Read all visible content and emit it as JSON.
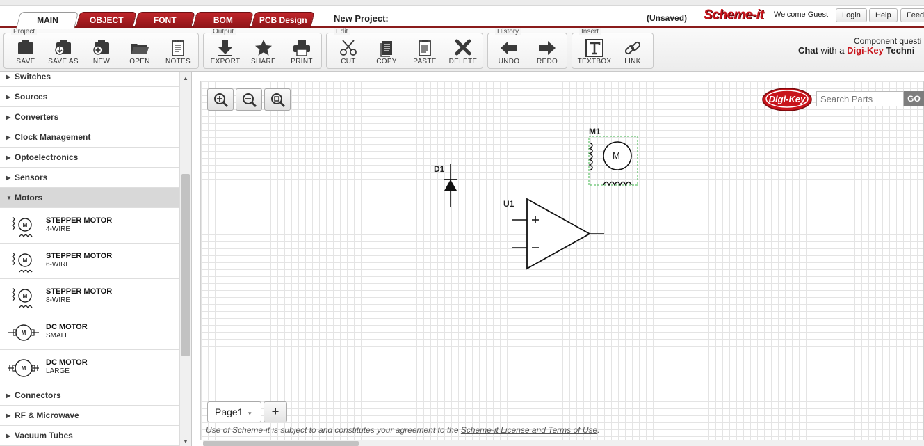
{
  "tabs": [
    {
      "label": "MAIN",
      "active": true
    },
    {
      "label": "OBJECT"
    },
    {
      "label": "FONT"
    },
    {
      "label": "BOM"
    },
    {
      "label": "PCB Design"
    }
  ],
  "header": {
    "project_label": "New Project:",
    "unsaved": "(Unsaved)",
    "brand": "Scheme-it",
    "welcome": "Welcome Guest",
    "buttons": {
      "login": "Login",
      "help": "Help",
      "feedback": "Feed"
    }
  },
  "toolbar": {
    "groups": {
      "project": "Project",
      "output": "Output",
      "edit": "Edit",
      "history": "History",
      "insert": "Insert"
    },
    "buttons": {
      "save": "SAVE",
      "save_as": "SAVE AS",
      "new": "NEW",
      "open": "OPEN",
      "notes": "NOTES",
      "export": "EXPORT",
      "share": "SHARE",
      "print": "PRINT",
      "cut": "CUT",
      "copy": "COPY",
      "paste": "PASTE",
      "delete": "DELETE",
      "undo": "UNDO",
      "redo": "REDO",
      "textbox": "TEXTBOX",
      "link": "LINK"
    }
  },
  "chat": {
    "question": "Component questi",
    "chat": "Chat",
    "with_a": " with a ",
    "brand": "Digi-Key",
    "rest": " Techni"
  },
  "sidebar": {
    "categories_top": [
      "Switches",
      "Sources",
      "Converters",
      "Clock Management",
      "Optoelectronics",
      "Sensors"
    ],
    "open_category": "Motors",
    "items": [
      {
        "name": "STEPPER MOTOR",
        "sub": "4-WIRE",
        "icon": "stepper-motor-icon"
      },
      {
        "name": "STEPPER MOTOR",
        "sub": "6-WIRE",
        "icon": "stepper-motor-icon"
      },
      {
        "name": "STEPPER MOTOR",
        "sub": "8-WIRE",
        "icon": "stepper-motor-icon"
      },
      {
        "name": "DC MOTOR",
        "sub": "SMALL",
        "icon": "dc-motor-icon"
      },
      {
        "name": "DC MOTOR",
        "sub": "LARGE",
        "icon": "dc-motor-icon"
      }
    ],
    "categories_bottom": [
      "Connectors",
      "RF & Microwave",
      "Vacuum Tubes"
    ]
  },
  "canvas": {
    "search_placeholder": "Search Parts",
    "go_label": "GO",
    "logo_text": "Digi-Key",
    "components": {
      "diode": "D1",
      "motor": "M1",
      "motor_letter": "M",
      "opamp": "U1"
    },
    "page_tab": "Page1",
    "add_page": "+",
    "terms_prefix": "Use of Scheme-it is subject to and constitutes your agreement to the ",
    "terms_link": "Scheme-it License and Terms of Use",
    "terms_suffix": "."
  },
  "colors": {
    "accent": "#c0262b",
    "grid": "#e4e4e4",
    "selection": "#3cb54a"
  }
}
